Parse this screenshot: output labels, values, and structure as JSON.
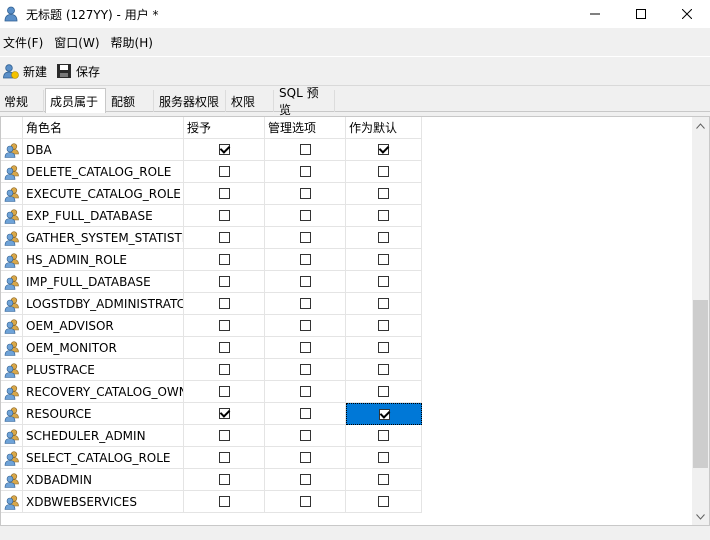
{
  "window": {
    "title": "无标题 (127YY) - 用户 *",
    "icon": "user-icon"
  },
  "menu": [
    "文件(F)",
    "窗口(W)",
    "帮助(H)"
  ],
  "toolbar": {
    "new_label": "新建",
    "save_label": "保存"
  },
  "tabs": [
    "常规",
    "成员属于",
    "配额",
    "服务器权限",
    "权限",
    "SQL 预览"
  ],
  "active_tab": "成员属于",
  "grid": {
    "columns": [
      "角色名",
      "授予",
      "管理选项",
      "作为默认"
    ],
    "rows": [
      {
        "name": "DBA",
        "grant": true,
        "admin": false,
        "default": true
      },
      {
        "name": "DELETE_CATALOG_ROLE",
        "grant": false,
        "admin": false,
        "default": false
      },
      {
        "name": "EXECUTE_CATALOG_ROLE",
        "grant": false,
        "admin": false,
        "default": false
      },
      {
        "name": "EXP_FULL_DATABASE",
        "grant": false,
        "admin": false,
        "default": false
      },
      {
        "name": "GATHER_SYSTEM_STATISTI",
        "grant": false,
        "admin": false,
        "default": false
      },
      {
        "name": "HS_ADMIN_ROLE",
        "grant": false,
        "admin": false,
        "default": false
      },
      {
        "name": "IMP_FULL_DATABASE",
        "grant": false,
        "admin": false,
        "default": false
      },
      {
        "name": "LOGSTDBY_ADMINISTRATC",
        "grant": false,
        "admin": false,
        "default": false
      },
      {
        "name": "OEM_ADVISOR",
        "grant": false,
        "admin": false,
        "default": false
      },
      {
        "name": "OEM_MONITOR",
        "grant": false,
        "admin": false,
        "default": false
      },
      {
        "name": "PLUSTRACE",
        "grant": false,
        "admin": false,
        "default": false
      },
      {
        "name": "RECOVERY_CATALOG_OWN",
        "grant": false,
        "admin": false,
        "default": false
      },
      {
        "name": "RESOURCE",
        "grant": true,
        "admin": false,
        "default": true,
        "selected_col": "default"
      },
      {
        "name": "SCHEDULER_ADMIN",
        "grant": false,
        "admin": false,
        "default": false
      },
      {
        "name": "SELECT_CATALOG_ROLE",
        "grant": false,
        "admin": false,
        "default": false
      },
      {
        "name": "XDBADMIN",
        "grant": false,
        "admin": false,
        "default": false
      },
      {
        "name": "XDBWEBSERVICES",
        "grant": false,
        "admin": false,
        "default": false
      }
    ]
  },
  "colors": {
    "selection": "#0078d7",
    "window_bg": "#f0f0f0"
  }
}
